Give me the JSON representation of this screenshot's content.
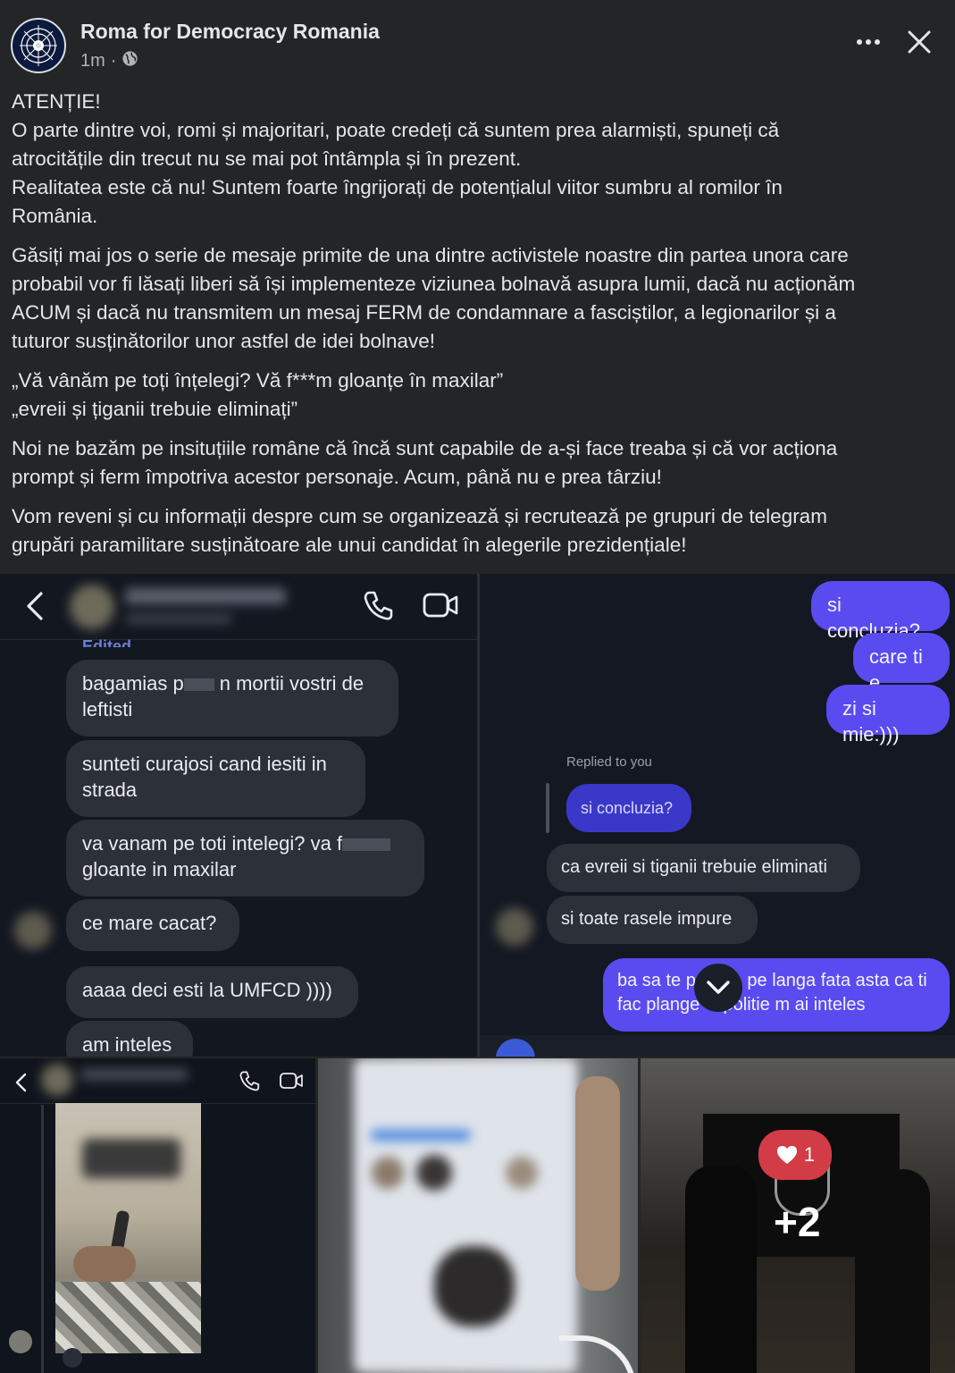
{
  "post": {
    "page_name": "Roma for Democracy Romania",
    "time": "1m",
    "separator": "·",
    "paragraphs": [
      [
        "ATENȚIE!",
        "O parte dintre voi, romi și majoritari, poate credeți că suntem prea alarmiști, spuneți că",
        "atrocitățile din trecut nu se mai pot întâmpla și în prezent.",
        "Realitatea este că nu! Suntem foarte îngrijorați de potențialul viitor sumbru al romilor în",
        "România."
      ],
      [
        "Găsiți mai jos o serie de mesaje primite de una dintre activistele noastre din partea unora care",
        "probabil vor fi lăsați liberi să își implementeze viziunea bolnavă asupra lumii, dacă nu acționăm",
        "ACUM și dacă nu transmitem un mesaj FERM de condamnare a fasciștilor, a legionarilor și a",
        "tuturor susținătorilor unor astfel de idei bolnave!"
      ],
      [
        "„Vă vânăm pe toți înțelegi? Vă f***m gloanțe în maxilar”",
        "„evreii și țiganii trebuie eliminați”"
      ],
      [
        "Noi ne bazăm pe insituțiile române că încă sunt capabile de a-și face treaba și că vor acționa",
        "prompt și ferm împotriva acestor personaje. Acum, până nu e prea târziu!"
      ],
      [
        "Vom reveni și cu informații despre cum se organizează și recrutează pe grupuri de telegram",
        "grupări paramilitare susținătoare ale unui candidat în alegerile prezidențiale!"
      ]
    ]
  },
  "chat_left": {
    "edited_label": "Edited",
    "messages": [
      {
        "a": "bagamias p",
        "b": "n mortii vostri de",
        "c": "leftisti"
      },
      {
        "a": "sunteti curajosi cand iesiti in",
        "c": "strada"
      },
      {
        "a": "va vanam pe toti intelegi? va f",
        "c": "gloante in maxilar"
      },
      {
        "a": "ce mare cacat?"
      },
      {
        "a": "aaaa deci esti la UMFCD ))))"
      },
      {
        "a": "am inteles"
      }
    ]
  },
  "chat_right": {
    "sent": [
      "si concluzia?",
      "care ti e",
      "zi si mie:)))"
    ],
    "replied_label": "Replied to you",
    "quoted": "si concluzia?",
    "received": [
      "ca evreii si tiganii trebuie eliminati",
      "si toate rasele impure"
    ],
    "last_sent_line1_a": "ba sa te p",
    "last_sent_line1_b": "pe langa fata asta ca ti",
    "last_sent_line2_a": "fac plange",
    "last_sent_line2_b": "a politie m ai inteles"
  },
  "gallery": {
    "reaction_count": "1",
    "more_count": "+2"
  },
  "colors": {
    "background": "#242526",
    "text": "#e4e6eb",
    "sent_bubble": "#5a4bf0",
    "received_bubble": "#2c3039",
    "reaction": "#d23c46"
  }
}
